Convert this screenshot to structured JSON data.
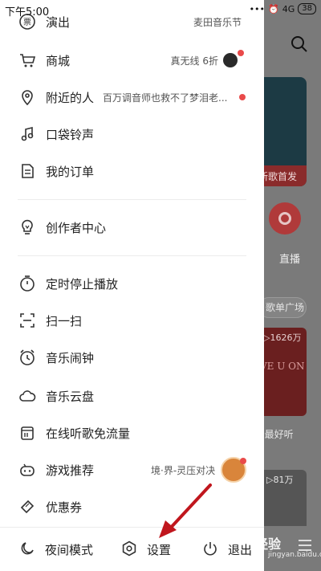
{
  "status_bar": {
    "time": "下午5:00",
    "network": "4G",
    "battery": "38"
  },
  "background": {
    "banner_caption": "新歌首发",
    "live_label": "直播",
    "pill_label": "歌单广场",
    "card1_count": "▷1626万",
    "card1_text": "VE U ON",
    "card1_caption": "n最好听",
    "card2_count": "▷81万"
  },
  "drawer": {
    "top_items": [
      {
        "icon": "ticket-icon",
        "label": "演出",
        "extra": "麦田音乐节"
      },
      {
        "icon": "cart-icon",
        "label": "商城",
        "extra": "真无线 6折"
      },
      {
        "icon": "location-pin-icon",
        "label": "附近的人",
        "extra": "百万调音师也救不了梦泪老..."
      },
      {
        "icon": "music-note-icon",
        "label": "口袋铃声"
      },
      {
        "icon": "document-icon",
        "label": "我的订单"
      }
    ],
    "creator_item": {
      "icon": "lightbulb-icon",
      "label": "创作者中心"
    },
    "tool_items": [
      {
        "icon": "timer-icon",
        "label": "定时停止播放"
      },
      {
        "icon": "scan-icon",
        "label": "扫一扫"
      },
      {
        "icon": "alarm-clock-icon",
        "label": "音乐闹钟"
      },
      {
        "icon": "cloud-icon",
        "label": "音乐云盘"
      },
      {
        "icon": "sim-card-icon",
        "label": "在线听歌免流量"
      },
      {
        "icon": "gamepad-icon",
        "label": "游戏推荐",
        "extra": "境·界-灵压对决"
      },
      {
        "icon": "coupon-icon",
        "label": "优惠券"
      }
    ],
    "bottom": {
      "night_mode": "夜间模式",
      "settings": "设置",
      "logout": "退出"
    }
  },
  "watermark": {
    "main": "经验",
    "sub": "jingyan.baidu.com"
  },
  "colors": {
    "accent": "#e94a4a",
    "drawer_bg": "#ffffff",
    "overlay": "#7a7a7a",
    "arrow": "#c0161d"
  }
}
